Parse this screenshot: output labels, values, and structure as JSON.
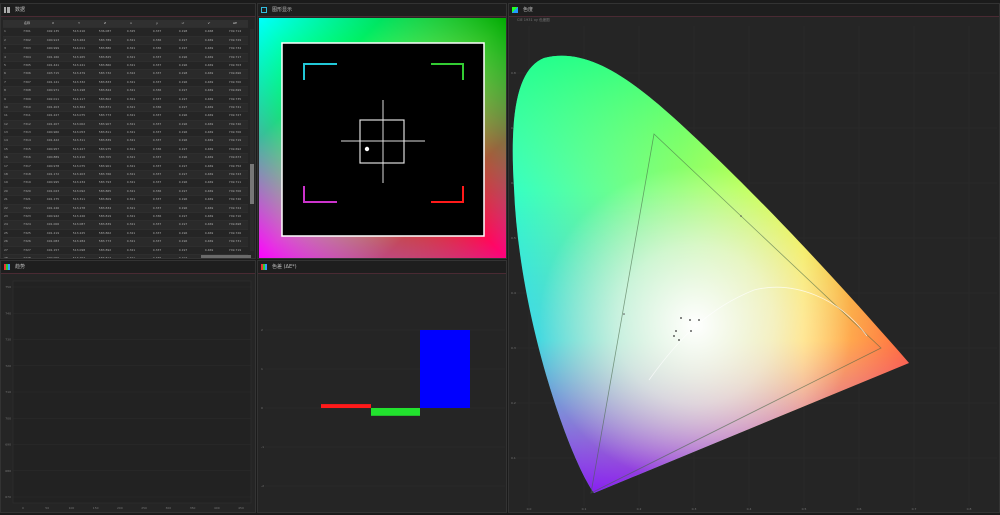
{
  "panels": {
    "data_title": "数据",
    "gamut_title": "图形显示",
    "trend_title": "趋势",
    "lab_title": "色差 (ΔE*)",
    "cie_title": "色度",
    "cie_subtitle": "CIE 1931 xy 色度图"
  },
  "table": {
    "headers": [
      "",
      "名称",
      "X",
      "Y",
      "Z",
      "x",
      "y",
      "u'",
      "v'",
      "ΔE"
    ],
    "rows": [
      [
        "1",
        "7301",
        "492.135",
        "513.216",
        "536.087",
        "0.325",
        "0.337",
        "0.198",
        "0.468",
        "749.714"
      ],
      [
        "2",
        "7302",
        "490.913",
        "513.264",
        "583.789",
        "0.321",
        "0.336",
        "0.197",
        "0.469",
        "749.729"
      ],
      [
        "3",
        "7303",
        "490.999",
        "514.011",
        "583.880",
        "0.321",
        "0.336",
        "0.197",
        "0.469",
        "749.734"
      ],
      [
        "4",
        "7304",
        "491.160",
        "513.265",
        "583.825",
        "0.321",
        "0.337",
        "0.196",
        "0.469",
        "749.717"
      ],
      [
        "5",
        "7305",
        "491.441",
        "513.241",
        "583.860",
        "0.321",
        "0.337",
        "0.196",
        "0.469",
        "749.703"
      ],
      [
        "6",
        "7306",
        "493.715",
        "513.479",
        "583.732",
        "0.322",
        "0.337",
        "0.198",
        "0.469",
        "749.696"
      ],
      [
        "7",
        "7307",
        "491.141",
        "513.332",
        "583.833",
        "0.321",
        "0.337",
        "0.196",
        "0.469",
        "749.700"
      ],
      [
        "8",
        "7308",
        "490.971",
        "513.198",
        "583.844",
        "0.321",
        "0.336",
        "0.197",
        "0.469",
        "749.699"
      ],
      [
        "9",
        "7309",
        "492.011",
        "514.117",
        "583.802",
        "0.321",
        "0.337",
        "0.197",
        "0.469",
        "749.735"
      ],
      [
        "10",
        "7310",
        "491.203",
        "513.364",
        "583.871",
        "0.321",
        "0.336",
        "0.197",
        "0.469",
        "749.741"
      ],
      [
        "11",
        "7311",
        "491.227",
        "513.075",
        "583.773",
        "0.321",
        "0.337",
        "0.196",
        "0.469",
        "749.727"
      ],
      [
        "12",
        "7312",
        "491.207",
        "513.002",
        "583.907",
        "0.321",
        "0.337",
        "0.196",
        "0.469",
        "749.740"
      ],
      [
        "13",
        "7313",
        "490.960",
        "513.053",
        "583.811",
        "0.321",
        "0.337",
        "0.196",
        "0.469",
        "749.706"
      ],
      [
        "14",
        "7314",
        "491.422",
        "513.311",
        "583.839",
        "0.321",
        "0.337",
        "0.196",
        "0.469",
        "749.719"
      ],
      [
        "15",
        "7315",
        "490.957",
        "513.227",
        "583.975",
        "0.321",
        "0.336",
        "0.197",
        "0.469",
        "749.692"
      ],
      [
        "16",
        "7316",
        "490.889",
        "513.216",
        "583.705",
        "0.321",
        "0.337",
        "0.196",
        "0.469",
        "749.673"
      ],
      [
        "17",
        "7317",
        "490.978",
        "513.075",
        "583.901",
        "0.321",
        "0.337",
        "0.197",
        "0.469",
        "749.752"
      ],
      [
        "18",
        "7318",
        "491.172",
        "513.203",
        "583.766",
        "0.321",
        "0.337",
        "0.197",
        "0.469",
        "749.743"
      ],
      [
        "19",
        "7319",
        "490.995",
        "513.234",
        "583.793",
        "0.321",
        "0.337",
        "0.196",
        "0.469",
        "749.711"
      ],
      [
        "20",
        "7320",
        "491.023",
        "513.092",
        "583.865",
        "0.321",
        "0.336",
        "0.197",
        "0.469",
        "749.706"
      ],
      [
        "21",
        "7321",
        "491.175",
        "513.311",
        "583.809",
        "0.321",
        "0.337",
        "0.196",
        "0.469",
        "749.740"
      ],
      [
        "22",
        "7322",
        "491.246",
        "513.278",
        "583.834",
        "0.321",
        "0.337",
        "0.196",
        "0.469",
        "749.724"
      ],
      [
        "23",
        "7323",
        "490.942",
        "513.226",
        "583.819",
        "0.321",
        "0.336",
        "0.197",
        "0.469",
        "749.710"
      ],
      [
        "24",
        "7324",
        "491.006",
        "513.087",
        "583.839",
        "0.321",
        "0.337",
        "0.197",
        "0.469",
        "749.698"
      ],
      [
        "25",
        "7325",
        "491.219",
        "513.225",
        "583.862",
        "0.321",
        "0.337",
        "0.196",
        "0.469",
        "749.726"
      ],
      [
        "26",
        "7326",
        "491.083",
        "513.284",
        "583.773",
        "0.321",
        "0.337",
        "0.196",
        "0.469",
        "749.731"
      ],
      [
        "27",
        "7327",
        "491.157",
        "513.098",
        "583.892",
        "0.321",
        "0.337",
        "0.197",
        "0.469",
        "749.719"
      ],
      [
        "28",
        "7328",
        "490.956",
        "513.257",
        "583.817",
        "0.321",
        "0.336",
        "0.197",
        "0.469",
        "749.703"
      ],
      [
        "29",
        "7329",
        "491.188",
        "513.268",
        "583.843",
        "0.321",
        "0.337",
        "0.196",
        "0.469",
        "749.736"
      ],
      [
        "30",
        "7330",
        "491.011",
        "513.151",
        "583.821",
        "0.321",
        "0.337",
        "0.197",
        "0.469",
        "749.712"
      ]
    ]
  },
  "trend_axis": {
    "y_ticks": [
      "750",
      "740",
      "730",
      "720",
      "710",
      "700",
      "690",
      "680",
      "670"
    ],
    "x_ticks": [
      "0",
      "50",
      "100",
      "150",
      "200",
      "250",
      "300",
      "350",
      "400",
      "450"
    ]
  },
  "lab_chart": {
    "y_ticks": [
      "2",
      "1",
      "0",
      "-1",
      "-2",
      "-3"
    ],
    "bars": [
      {
        "name": "R",
        "value": 0.1,
        "color": "#ff1a1a"
      },
      {
        "name": "G",
        "value": -0.2,
        "color": "#22e22e"
      },
      {
        "name": "B",
        "value": 2.0,
        "color": "#0000ff"
      }
    ]
  },
  "cie_axis": {
    "y_ticks": [
      "0.8",
      "0.7",
      "0.6",
      "0.5",
      "0.4",
      "0.3",
      "0.2",
      "0.1"
    ],
    "x_ticks": [
      "0.0",
      "0.1",
      "0.2",
      "0.3",
      "0.4",
      "0.5",
      "0.6",
      "0.7",
      "0.8"
    ]
  },
  "colors": {
    "bg": "#1b1b1b",
    "panel": "#252525",
    "accent": "#4a2a33"
  }
}
